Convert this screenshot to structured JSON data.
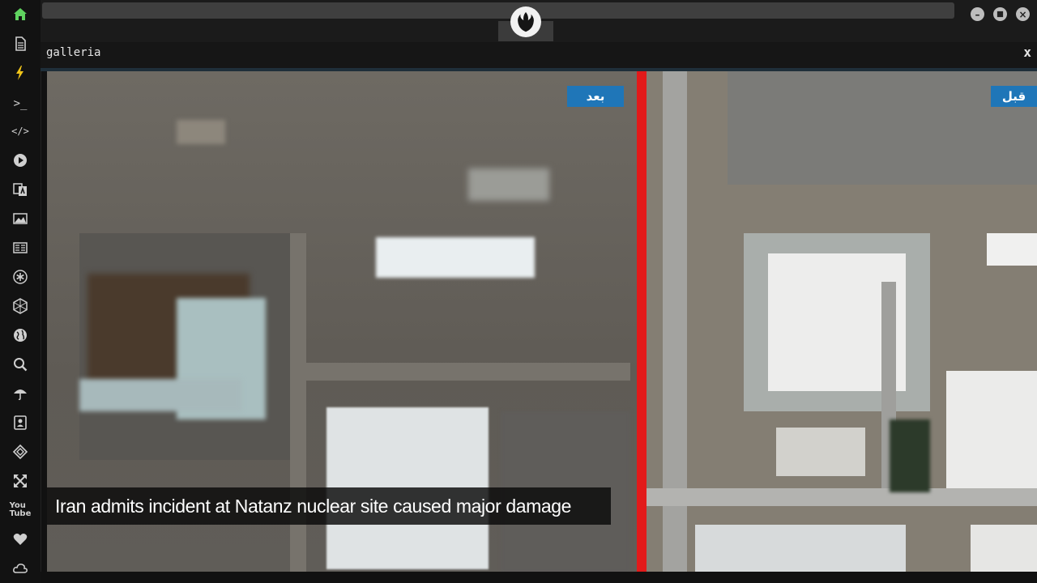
{
  "sidebar": {
    "items": [
      {
        "icon": "home-icon",
        "glyph": "⌂"
      },
      {
        "icon": "document-icon",
        "glyph": "▤"
      },
      {
        "icon": "bolt-icon",
        "glyph": "ϟ"
      },
      {
        "icon": "terminal-icon",
        "glyph": ">_"
      },
      {
        "icon": "code-icon",
        "glyph": "</>"
      },
      {
        "icon": "play-icon",
        "glyph": "▶"
      },
      {
        "icon": "translate-icon",
        "glyph": "A"
      },
      {
        "icon": "image-icon",
        "glyph": "▣"
      },
      {
        "icon": "newspaper-icon",
        "glyph": "▦"
      },
      {
        "icon": "asterisk-icon",
        "glyph": "✳"
      },
      {
        "icon": "hexagon-icon",
        "glyph": "⬡"
      },
      {
        "icon": "globe-icon",
        "glyph": "◍"
      },
      {
        "icon": "search-icon",
        "glyph": "⌕"
      },
      {
        "icon": "umbrella-icon",
        "glyph": "☂"
      },
      {
        "icon": "contact-card-icon",
        "glyph": "▧"
      },
      {
        "icon": "diamond-arrows-icon",
        "glyph": "◈"
      },
      {
        "icon": "expand-icon",
        "glyph": "⤧"
      },
      {
        "icon": "youtube-icon",
        "glyph": "You"
      },
      {
        "icon": "heart-icon",
        "glyph": "♥"
      },
      {
        "icon": "cloud-icon",
        "glyph": "☁"
      }
    ]
  },
  "topbar": {
    "logo_icon": "rebel-alliance-logo-icon",
    "window_controls": [
      "minimize",
      "maximize",
      "close"
    ]
  },
  "window": {
    "title": "galleria",
    "close_label": "x"
  },
  "image": {
    "badge_after": "بعد",
    "badge_before": "قبل",
    "caption": "Iran admits incident at Natanz nuclear site caused major damage"
  },
  "colors": {
    "active_icon": "#5fd35f",
    "bolt_icon": "#f0c419",
    "divider": "#e21a1a",
    "badge": "#1f76b8"
  }
}
